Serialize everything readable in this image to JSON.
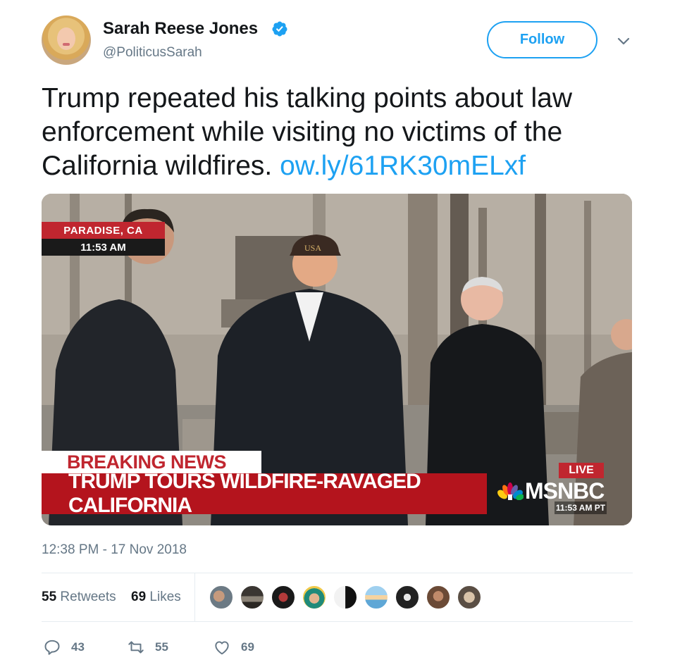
{
  "author": {
    "name": "Sarah Reese Jones",
    "handle": "@PoliticusSarah",
    "verified": true
  },
  "header": {
    "follow_label": "Follow",
    "more_icon": "chevron-down-icon"
  },
  "tweet": {
    "text": "Trump repeated his talking points about law enforcement while visiting no victims of the California wildfires. ",
    "link": "ow.ly/61RK30mELxf"
  },
  "media": {
    "location": "PARADISE, CA",
    "time": "11:53 AM",
    "breaking": "BREAKING NEWS",
    "headline": "TRUMP TOURS WILDFIRE-RAVAGED CALIFORNIA",
    "live": "LIVE",
    "network": "MSNBC",
    "network_time": "11:53 AM PT",
    "cap_text": "USA"
  },
  "meta": {
    "timestamp": "12:38 PM - 17 Nov 2018"
  },
  "stats": {
    "retweets_count": "55",
    "retweets_label": "Retweets",
    "likes_count": "69",
    "likes_label": "Likes"
  },
  "actions": {
    "reply_count": "43",
    "retweet_count": "55",
    "like_count": "69"
  },
  "colors": {
    "accent": "#1da1f2",
    "breaking_red": "#c0262f",
    "secondary_text": "#657786"
  }
}
